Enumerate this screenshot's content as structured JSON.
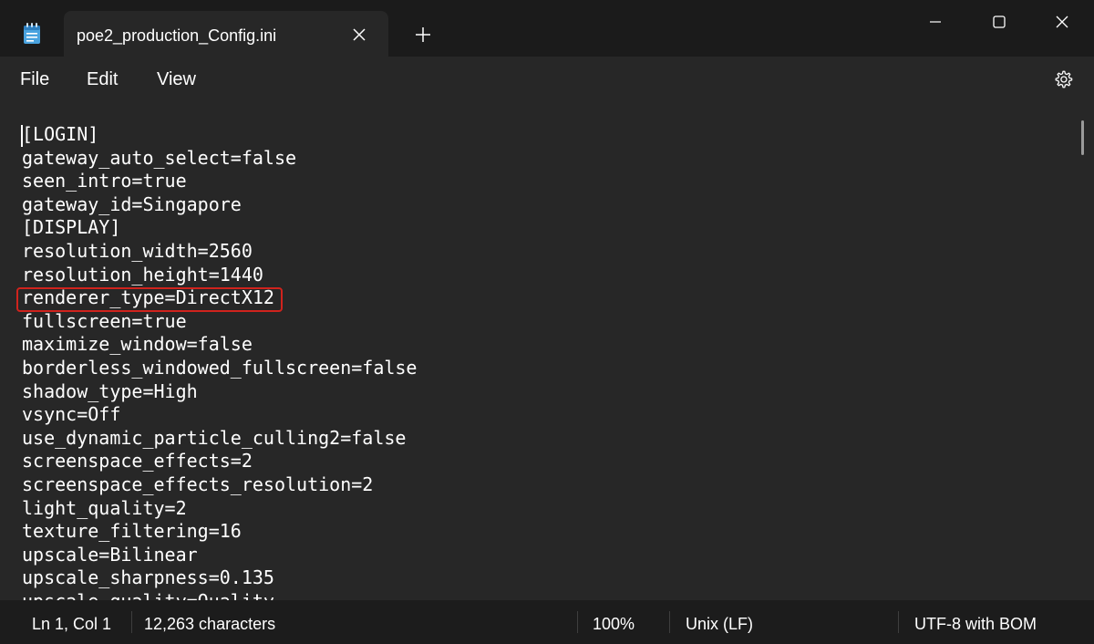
{
  "window": {
    "tab_title": "poe2_production_Config.ini"
  },
  "menu": {
    "file": "File",
    "edit": "Edit",
    "view": "View"
  },
  "icons": {
    "app": "notepad-icon",
    "tab_close": "close-icon",
    "new_tab": "plus-icon",
    "minimize": "minimize-icon",
    "maximize": "maximize-icon",
    "close": "close-icon",
    "settings": "gear-icon"
  },
  "colors": {
    "highlight_border": "#d0231d",
    "background": "#272727"
  },
  "editor": {
    "lines": [
      "[LOGIN]",
      "gateway_auto_select=false",
      "seen_intro=true",
      "gateway_id=Singapore",
      "[DISPLAY]",
      "resolution_width=2560",
      "resolution_height=1440",
      "renderer_type=DirectX12",
      "fullscreen=true",
      "maximize_window=false",
      "borderless_windowed_fullscreen=false",
      "shadow_type=High",
      "vsync=Off",
      "use_dynamic_particle_culling2=false",
      "screenspace_effects=2",
      "screenspace_effects_resolution=2",
      "light_quality=2",
      "texture_filtering=16",
      "upscale=Bilinear",
      "upscale_sharpness=0.135",
      "upscale_quality=Quality"
    ],
    "highlighted_line": "renderer_type=DirectX12"
  },
  "status": {
    "position": "Ln 1, Col 1",
    "characters": "12,263 characters",
    "zoom": "100%",
    "line_ending": "Unix (LF)",
    "encoding": "UTF-8 with BOM"
  }
}
